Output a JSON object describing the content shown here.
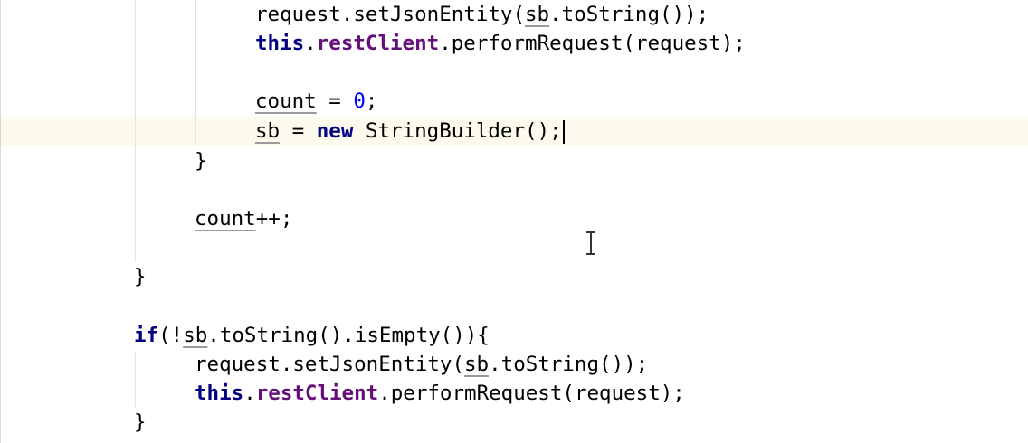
{
  "editor": {
    "lines": [
      {
        "tokens": [
          {
            "t": "request.setJsonEntity(",
            "c": "tok"
          },
          {
            "t": "sb",
            "c": "var"
          },
          {
            "t": ".toString());",
            "c": "tok"
          }
        ]
      },
      {
        "tokens": [
          {
            "t": "this",
            "c": "kw"
          },
          {
            "t": ".",
            "c": "tok"
          },
          {
            "t": "restClient",
            "c": "field"
          },
          {
            "t": ".performRequest(request);",
            "c": "tok"
          }
        ]
      },
      {
        "tokens": []
      },
      {
        "tokens": [
          {
            "t": "count",
            "c": "var"
          },
          {
            "t": " = ",
            "c": "tok"
          },
          {
            "t": "0",
            "c": "num"
          },
          {
            "t": ";",
            "c": "tok"
          }
        ]
      },
      {
        "tokens": [
          {
            "t": "sb",
            "c": "var"
          },
          {
            "t": " = ",
            "c": "tok"
          },
          {
            "t": "new",
            "c": "kw"
          },
          {
            "t": " StringBuilder();",
            "c": "tok"
          }
        ],
        "caret": true
      },
      {
        "tokens": [
          {
            "t": "}",
            "c": "tok"
          }
        ]
      },
      {
        "tokens": []
      },
      {
        "tokens": [
          {
            "t": "count",
            "c": "var"
          },
          {
            "t": "++;",
            "c": "tok"
          }
        ]
      },
      {
        "tokens": []
      },
      {
        "tokens": [
          {
            "t": "}",
            "c": "tok"
          }
        ]
      },
      {
        "tokens": []
      },
      {
        "tokens": [
          {
            "t": "if",
            "c": "kw"
          },
          {
            "t": "(!",
            "c": "tok"
          },
          {
            "t": "sb",
            "c": "var"
          },
          {
            "t": ".toString().isEmpty()){",
            "c": "tok"
          }
        ]
      },
      {
        "tokens": [
          {
            "t": "request.setJsonEntity(",
            "c": "tok"
          },
          {
            "t": "sb",
            "c": "var"
          },
          {
            "t": ".toString());",
            "c": "tok"
          }
        ]
      },
      {
        "tokens": [
          {
            "t": "this",
            "c": "kw"
          },
          {
            "t": ".",
            "c": "tok"
          },
          {
            "t": "restClient",
            "c": "field"
          },
          {
            "t": ".performRequest(request);",
            "c": "tok"
          }
        ]
      },
      {
        "tokens": [
          {
            "t": "}",
            "c": "tok"
          }
        ]
      }
    ]
  }
}
